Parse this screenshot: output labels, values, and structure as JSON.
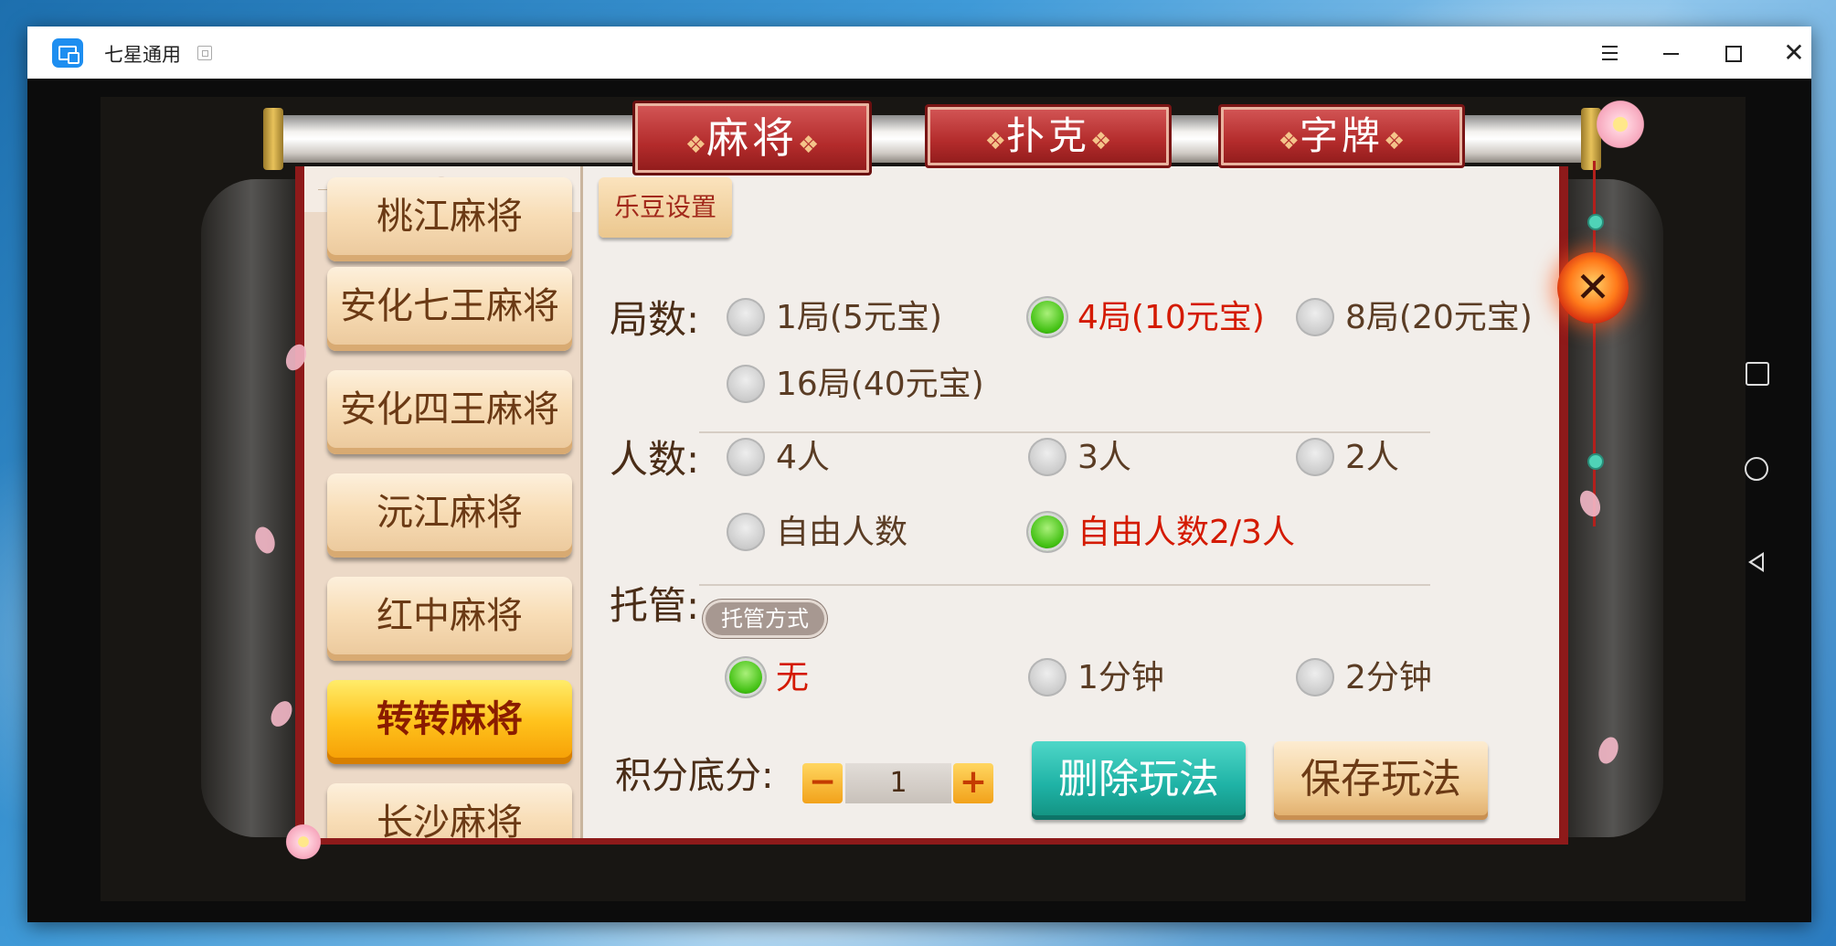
{
  "window": {
    "title": "七星通用"
  },
  "tabs": [
    {
      "label": "麻将",
      "active": true
    },
    {
      "label": "扑克",
      "active": false
    },
    {
      "label": "字牌",
      "active": false
    }
  ],
  "game_list": [
    {
      "label": "桃江麻将",
      "selected": false
    },
    {
      "label": "安化七王麻将",
      "selected": false
    },
    {
      "label": "安化四王麻将",
      "selected": false
    },
    {
      "label": "沅江麻将",
      "selected": false
    },
    {
      "label": "红中麻将",
      "selected": false
    },
    {
      "label": "转转麻将",
      "selected": true
    },
    {
      "label": "长沙麻将",
      "selected": false
    }
  ],
  "settings": {
    "ledou_button": "乐豆设置",
    "rounds": {
      "label": "局数:",
      "options": [
        {
          "label": "1局(5元宝)",
          "selected": false
        },
        {
          "label": "4局(10元宝)",
          "selected": true
        },
        {
          "label": "8局(20元宝)",
          "selected": false
        },
        {
          "label": "16局(40元宝)",
          "selected": false
        }
      ]
    },
    "players": {
      "label": "人数:",
      "options": [
        {
          "label": "4人",
          "selected": false
        },
        {
          "label": "3人",
          "selected": false
        },
        {
          "label": "2人",
          "selected": false
        },
        {
          "label": "自由人数",
          "selected": false
        },
        {
          "label": "自由人数2/3人",
          "selected": true
        }
      ]
    },
    "autoplay": {
      "label": "托管:",
      "badge": "托管方式",
      "options": [
        {
          "label": "无",
          "selected": true
        },
        {
          "label": "1分钟",
          "selected": false
        },
        {
          "label": "2分钟",
          "selected": false
        }
      ]
    },
    "base_score": {
      "label": "积分底分:",
      "minus": "−",
      "value": "1",
      "plus": "+"
    },
    "delete_button": "删除玩法",
    "save_button": "保存玩法",
    "close_symbol": "✕"
  },
  "colors": {
    "selected_text": "#d41a00",
    "frame_red": "#8e1a1a",
    "teal_button": "#1fb3a6"
  }
}
